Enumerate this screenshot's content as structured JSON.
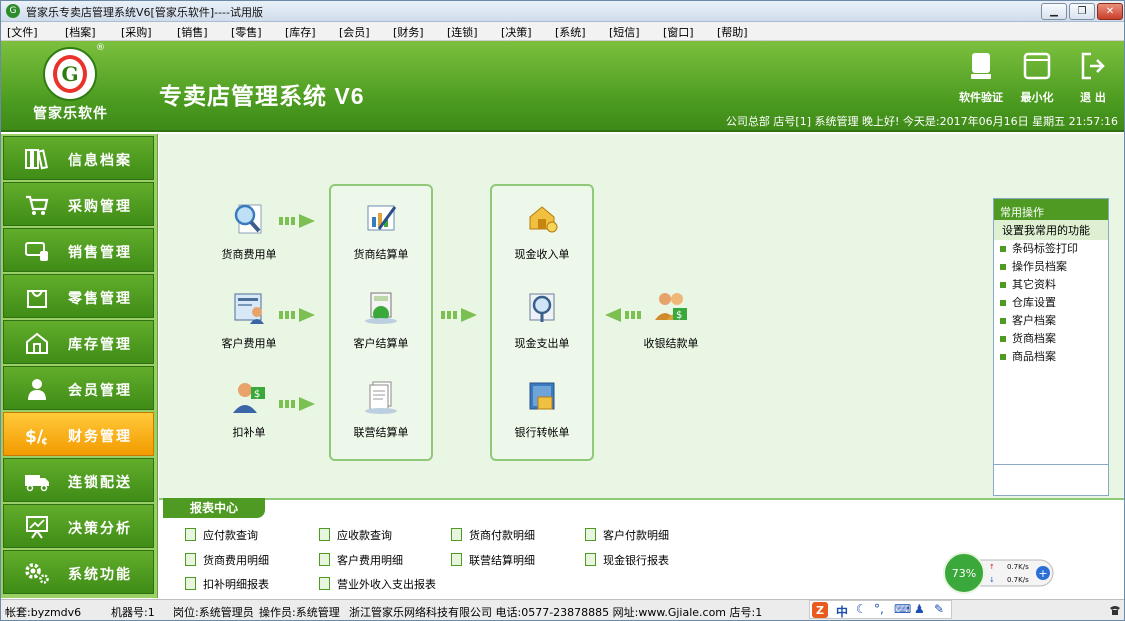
{
  "window": {
    "title": "管家乐专卖店管理系统V6[管家乐软件]----试用版",
    "min": "▁",
    "max": "❐",
    "close": "✕"
  },
  "menu": [
    "[文件]",
    "[档案]",
    "[采购]",
    "[销售]",
    "[零售]",
    "[库存]",
    "[会员]",
    "[财务]",
    "[连锁]",
    "[决策]",
    "[系统]",
    "[短信]",
    "[窗口]",
    "[帮助]"
  ],
  "banner": {
    "logo_letter": "G",
    "logo_text": "管家乐软件",
    "app_title": "专卖店管理系统 V6",
    "buttons": [
      "软件验证",
      "最小化",
      "退 出"
    ],
    "status_line": "公司总部 店号[1]  系统管理 晚上好! 今天是:2017年06月16日 星期五  21:57:16"
  },
  "sidebar": {
    "items": [
      "信息档案",
      "采购管理",
      "销售管理",
      "零售管理",
      "库存管理",
      "会员管理",
      "财务管理",
      "连锁配送",
      "决策分析",
      "系统功能"
    ],
    "active": "财务管理"
  },
  "flow": {
    "left": [
      "货商费用单",
      "客户费用单",
      "扣补单"
    ],
    "middle": [
      "货商结算单",
      "客户结算单",
      "联营结算单"
    ],
    "right": [
      "现金收入单",
      "现金支出单",
      "银行转帐单"
    ],
    "far_right": "收银结款单"
  },
  "common_ops": {
    "title": "常用操作",
    "subtitle": "设置我常用的功能",
    "items": [
      "条码标签打印",
      "操作员档案",
      "其它资料",
      "仓库设置",
      "客户档案",
      "货商档案",
      "商品档案"
    ]
  },
  "report_center": {
    "title": "报表中心",
    "items": [
      "应付款查询",
      "应收款查询",
      "货商付款明细",
      "客户付款明细",
      "货商费用明细",
      "客户费用明细",
      "联营结算明细",
      "现金银行报表",
      "扣补明细报表",
      "营业外收入支出报表"
    ]
  },
  "gauge": {
    "percent": "73%",
    "up": "0.7K/s",
    "down": "0.7K/s"
  },
  "statusbar": {
    "account": "帐套:byzmdv6",
    "machine": "机器号:1",
    "post": "岗位:系统管理员",
    "operator": "操作员:系统管理",
    "company": "浙江管家乐网络科技有限公司 电话:0577-23878885 网址:www.Gjiale.com 店号:1"
  },
  "ime": {
    "brand": "Z",
    "lang": "中"
  },
  "colors": {
    "banner_green": "#4a9a1f",
    "sidebar_bg": "#9bd067",
    "active_orange": "#f39a00",
    "main_bg": "#eaf6e4"
  }
}
